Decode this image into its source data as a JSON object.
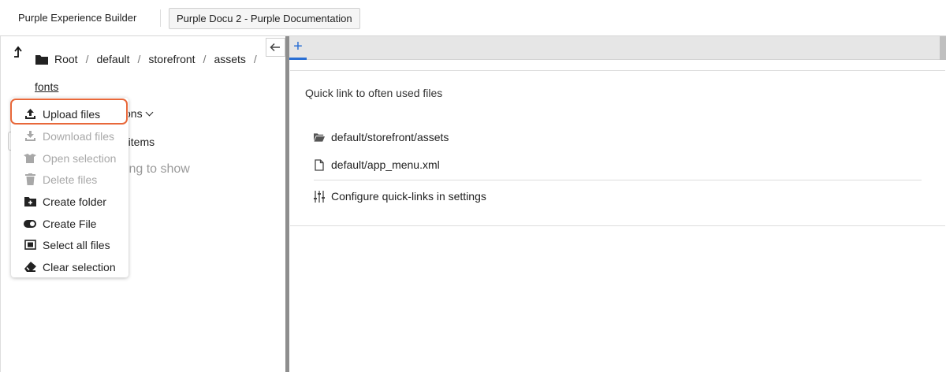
{
  "header": {
    "app_title": "Purple Experience Builder",
    "project_button": "Purple Docu 2 - Purple Documentation"
  },
  "file_browser": {
    "breadcrumb": [
      {
        "label": "Root"
      },
      {
        "label": "default"
      },
      {
        "label": "storefront"
      },
      {
        "label": "assets"
      }
    ],
    "breadcrumb_separator": "/",
    "current_folder": "fonts",
    "actions_label": "tions",
    "items_count": "0 items",
    "empty_text": "hing to show"
  },
  "actions_menu": {
    "items": [
      {
        "label": "Upload files",
        "icon": "upload-icon",
        "enabled": true
      },
      {
        "label": "Download files",
        "icon": "download-icon",
        "enabled": false
      },
      {
        "label": "Open selection",
        "icon": "open-box-icon",
        "enabled": false
      },
      {
        "label": "Delete files",
        "icon": "trash-icon",
        "enabled": false
      },
      {
        "label": "Create folder",
        "icon": "folder-plus-icon",
        "enabled": true
      },
      {
        "label": "Create File",
        "icon": "toggle-icon",
        "enabled": true
      },
      {
        "label": "Select all files",
        "icon": "select-all-icon",
        "enabled": true
      },
      {
        "label": "Clear selection",
        "icon": "eraser-icon",
        "enabled": true
      }
    ]
  },
  "tabs": {
    "add_label": "+"
  },
  "quick_links": {
    "title": "Quick link to often used files",
    "links": [
      {
        "label": "default/storefront/assets",
        "icon": "folder-open-icon"
      },
      {
        "label": "default/app_menu.xml",
        "icon": "file-icon"
      }
    ],
    "configure_label": "Configure quick-links in settings",
    "configure_icon": "sliders-icon"
  },
  "colors": {
    "highlight": "#e8683a",
    "accent": "#2a6fd4",
    "disabled_text": "#a8a8a8"
  }
}
